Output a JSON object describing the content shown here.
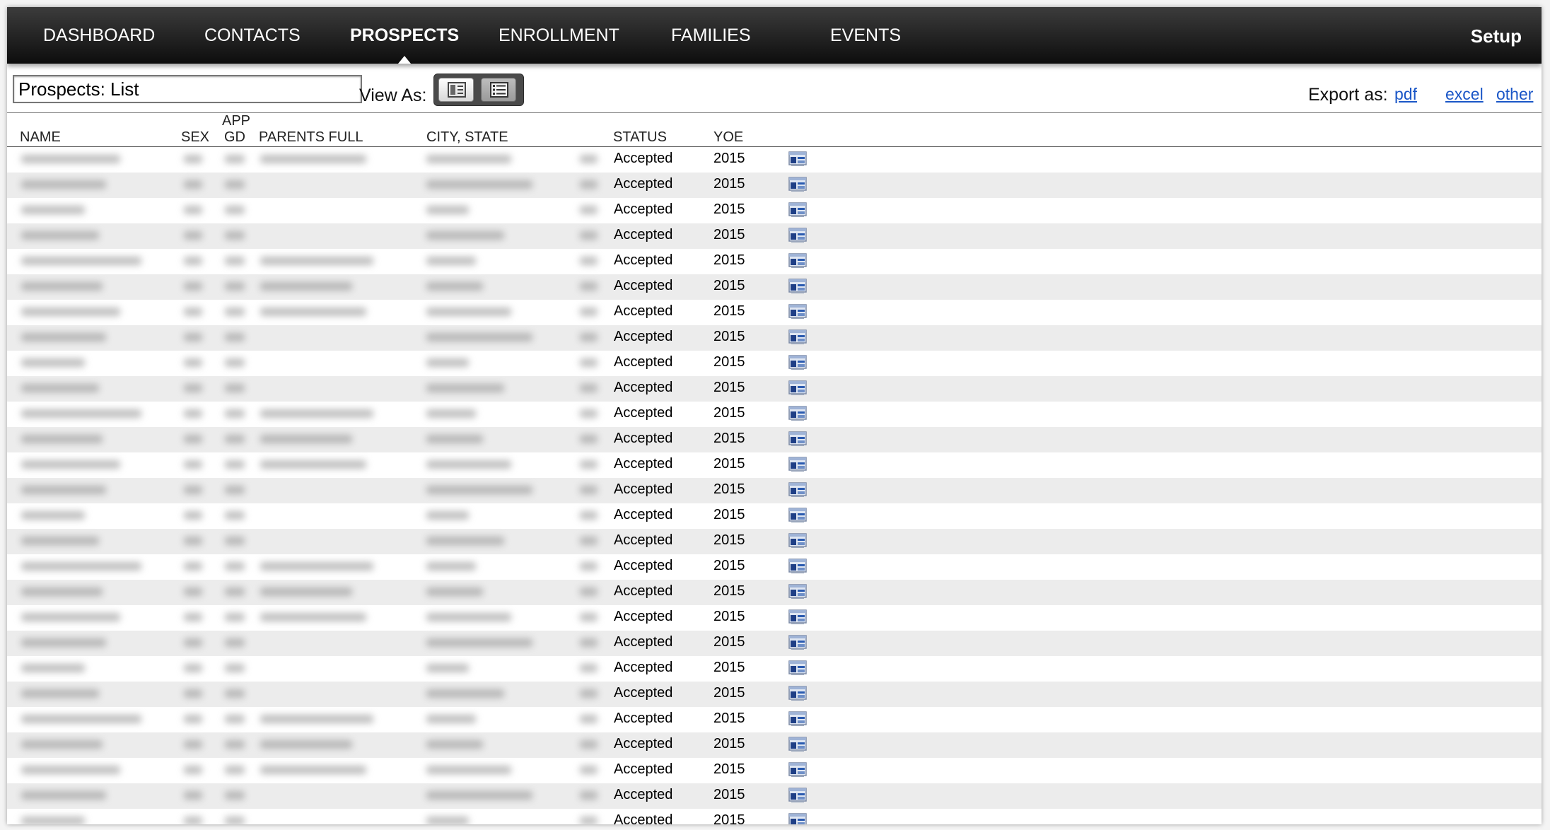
{
  "nav": {
    "items": [
      {
        "label": "DASHBOARD",
        "active": false
      },
      {
        "label": "CONTACTS",
        "active": false
      },
      {
        "label": "PROSPECTS",
        "active": true
      },
      {
        "label": "ENROLLMENT",
        "active": false
      },
      {
        "label": "FAMILIES",
        "active": false
      },
      {
        "label": "EVENTS",
        "active": false
      }
    ],
    "setup_label": "Setup"
  },
  "toolbar": {
    "list_title": "Prospects: List",
    "view_as_label": "View As:",
    "view_modes": [
      {
        "name": "grid-view",
        "selected": false
      },
      {
        "name": "list-view",
        "selected": true
      }
    ],
    "export_label": "Export as:",
    "export_links": [
      "pdf",
      "excel",
      "other"
    ]
  },
  "table": {
    "headers": {
      "name": "NAME",
      "sex": "SEX",
      "app_gd_line1": "APP",
      "app_gd_line2": "GD",
      "parents_full": "PARENTS FULL",
      "city_state": "CITY, STATE",
      "status": "STATUS",
      "yoe": "YOE"
    },
    "row_icon": "record-card-icon",
    "rows": [
      {
        "status": "Accepted",
        "yoe": "2015"
      },
      {
        "status": "Accepted",
        "yoe": "2015"
      },
      {
        "status": "Accepted",
        "yoe": "2015"
      },
      {
        "status": "Accepted",
        "yoe": "2015"
      },
      {
        "status": "Accepted",
        "yoe": "2015"
      },
      {
        "status": "Accepted",
        "yoe": "2015"
      },
      {
        "status": "Accepted",
        "yoe": "2015"
      },
      {
        "status": "Accepted",
        "yoe": "2015"
      },
      {
        "status": "Accepted",
        "yoe": "2015"
      },
      {
        "status": "Accepted",
        "yoe": "2015"
      },
      {
        "status": "Accepted",
        "yoe": "2015"
      },
      {
        "status": "Accepted",
        "yoe": "2015"
      },
      {
        "status": "Accepted",
        "yoe": "2015"
      },
      {
        "status": "Accepted",
        "yoe": "2015"
      },
      {
        "status": "Accepted",
        "yoe": "2015"
      },
      {
        "status": "Accepted",
        "yoe": "2015"
      },
      {
        "status": "Accepted",
        "yoe": "2015"
      },
      {
        "status": "Accepted",
        "yoe": "2015"
      },
      {
        "status": "Accepted",
        "yoe": "2015"
      },
      {
        "status": "Accepted",
        "yoe": "2015"
      },
      {
        "status": "Accepted",
        "yoe": "2015"
      },
      {
        "status": "Accepted",
        "yoe": "2015"
      },
      {
        "status": "Accepted",
        "yoe": "2015"
      },
      {
        "status": "Accepted",
        "yoe": "2015"
      },
      {
        "status": "Accepted",
        "yoe": "2015"
      },
      {
        "status": "Accepted",
        "yoe": "2015"
      },
      {
        "status": "Accepted",
        "yoe": "2015"
      }
    ]
  },
  "colors": {
    "nav_bg": "#1a1a1a",
    "link": "#1a56c7",
    "row_alt": "#ececec"
  }
}
